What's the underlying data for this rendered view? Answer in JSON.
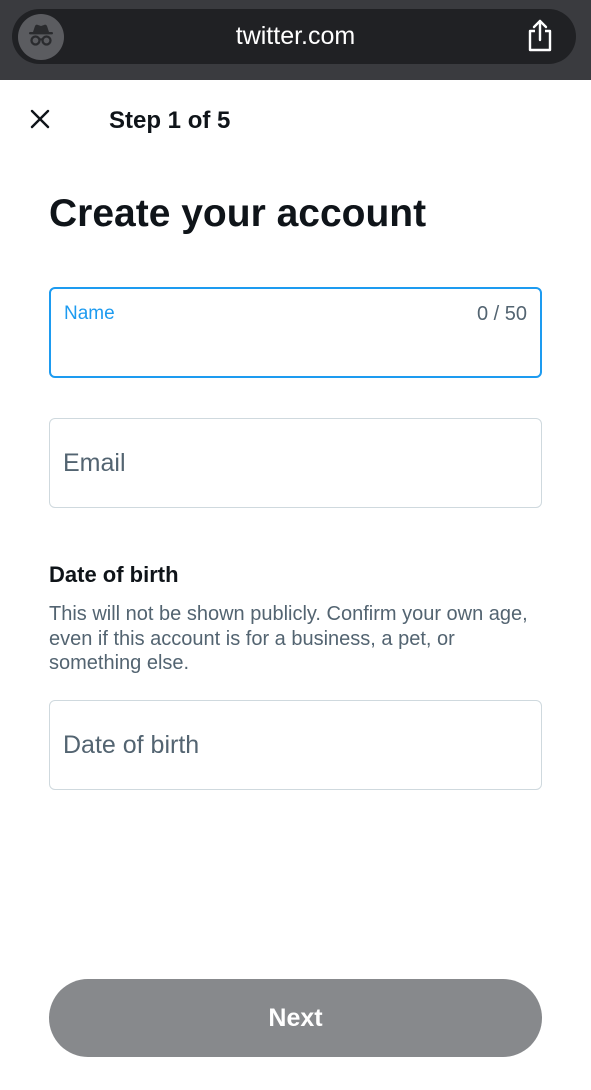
{
  "browser": {
    "url": "twitter.com",
    "left_icon": "incognito-icon",
    "right_icon": "share-icon"
  },
  "header": {
    "close_icon": "close-icon",
    "step": "Step 1 of 5"
  },
  "title": "Create your account",
  "form": {
    "name": {
      "label": "Name",
      "counter": "0 / 50",
      "value": ""
    },
    "email": {
      "placeholder": "Email",
      "value": ""
    },
    "dob": {
      "heading": "Date of birth",
      "description": "This will not be shown publicly. Confirm your own age, even if this account is for a business, a pet, or something else.",
      "placeholder": "Date of birth",
      "value": ""
    }
  },
  "actions": {
    "next_label": "Next"
  },
  "colors": {
    "accent": "#1d9bf0",
    "button_disabled": "#87898c",
    "text_primary": "#0f1419",
    "text_secondary": "#536471",
    "browser_bar": "#3a3b3f"
  }
}
